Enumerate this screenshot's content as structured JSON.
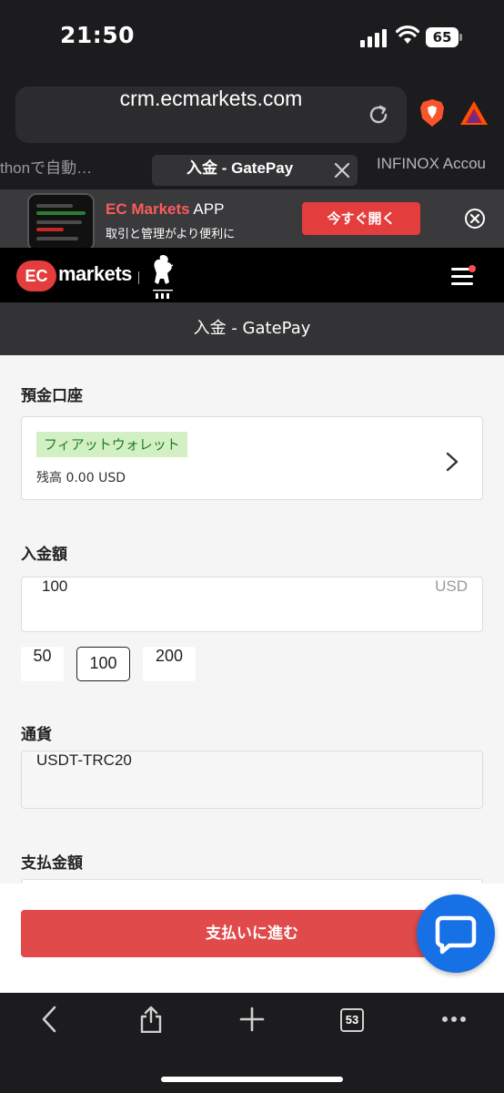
{
  "status_bar": {
    "time": "21:50",
    "battery": "65"
  },
  "browser": {
    "url": "crm.ecmarkets.com",
    "tabs": [
      {
        "label": "thonで自動…"
      },
      {
        "label": "入金 - GatePay"
      },
      {
        "label": "INFINOX Accou"
      }
    ],
    "tab_count": "53"
  },
  "app_banner": {
    "brand": "EC Markets",
    "app": "APP",
    "subtitle": "取引と管理がより便利に",
    "open_label": "今すぐ開く"
  },
  "site_header": {
    "logo_ec": "EC",
    "logo_markets": "markets"
  },
  "page": {
    "title": "入金 - GatePay",
    "deposit_account": {
      "label": "預金口座",
      "wallet_name": "フィアットウォレット",
      "balance": "残高 0.00 USD"
    },
    "deposit_amount": {
      "label": "入金額",
      "value": "100",
      "unit": "USD",
      "presets": [
        "50",
        "100",
        "200"
      ],
      "selected": "100"
    },
    "currency": {
      "label": "通貨",
      "value": "USDT-TRC20"
    },
    "payment_amount": {
      "label": "支払金額"
    },
    "proceed_label": "支払いに進む"
  },
  "colors": {
    "accent": "#e04a4a",
    "chat": "#1670e6",
    "wallet_badge_bg": "#d3f0c5"
  }
}
